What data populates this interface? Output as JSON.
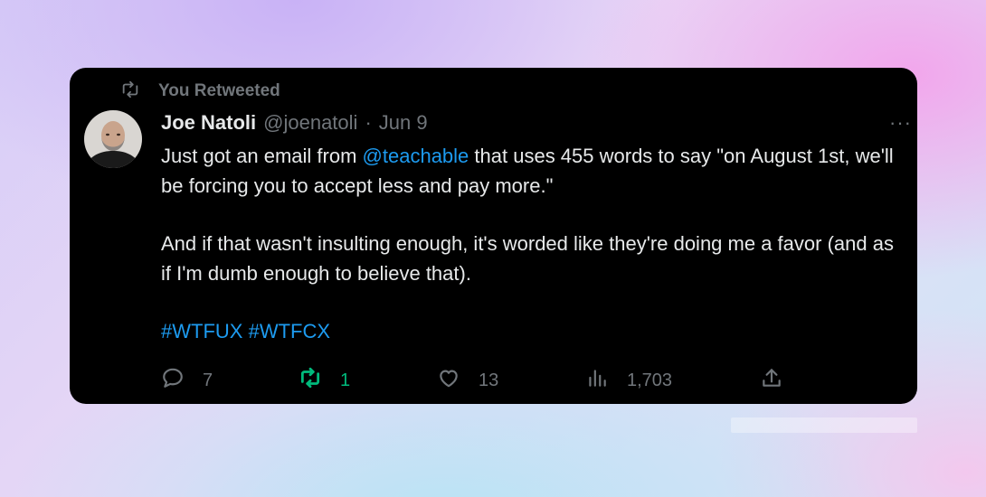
{
  "retweet_context": {
    "label": "You Retweeted",
    "icon": "retweet-icon"
  },
  "author": {
    "display_name": "Joe Natoli",
    "handle": "@joenatoli",
    "separator": "·",
    "date": "Jun 9"
  },
  "more_menu": {
    "label": "···",
    "icon": "more-icon"
  },
  "tweet": {
    "para1_before": "Just got an email from ",
    "mention": "@teachable",
    "para1_after": " that uses 455 words to say \"on August 1st, we'll be forcing you to accept less and pay more.\"",
    "para2": "And if that wasn't insulting enough, it's worded like they're doing me a favor (and as if I'm dumb enough to believe that).",
    "hashtag1": "#WTFUX",
    "hashtag2": "#WTFCX"
  },
  "actions": {
    "replies": {
      "count": "7",
      "icon": "reply-icon"
    },
    "retweets": {
      "count": "1",
      "icon": "retweet-icon",
      "active": true
    },
    "likes": {
      "count": "13",
      "icon": "heart-icon"
    },
    "views": {
      "count": "1,703",
      "icon": "views-icon"
    },
    "share": {
      "icon": "share-icon"
    }
  },
  "colors": {
    "card_bg": "#000000",
    "text_primary": "#e7e9ea",
    "text_secondary": "#71767b",
    "link": "#1d9bf0",
    "retweet_active": "#00ba7c"
  }
}
